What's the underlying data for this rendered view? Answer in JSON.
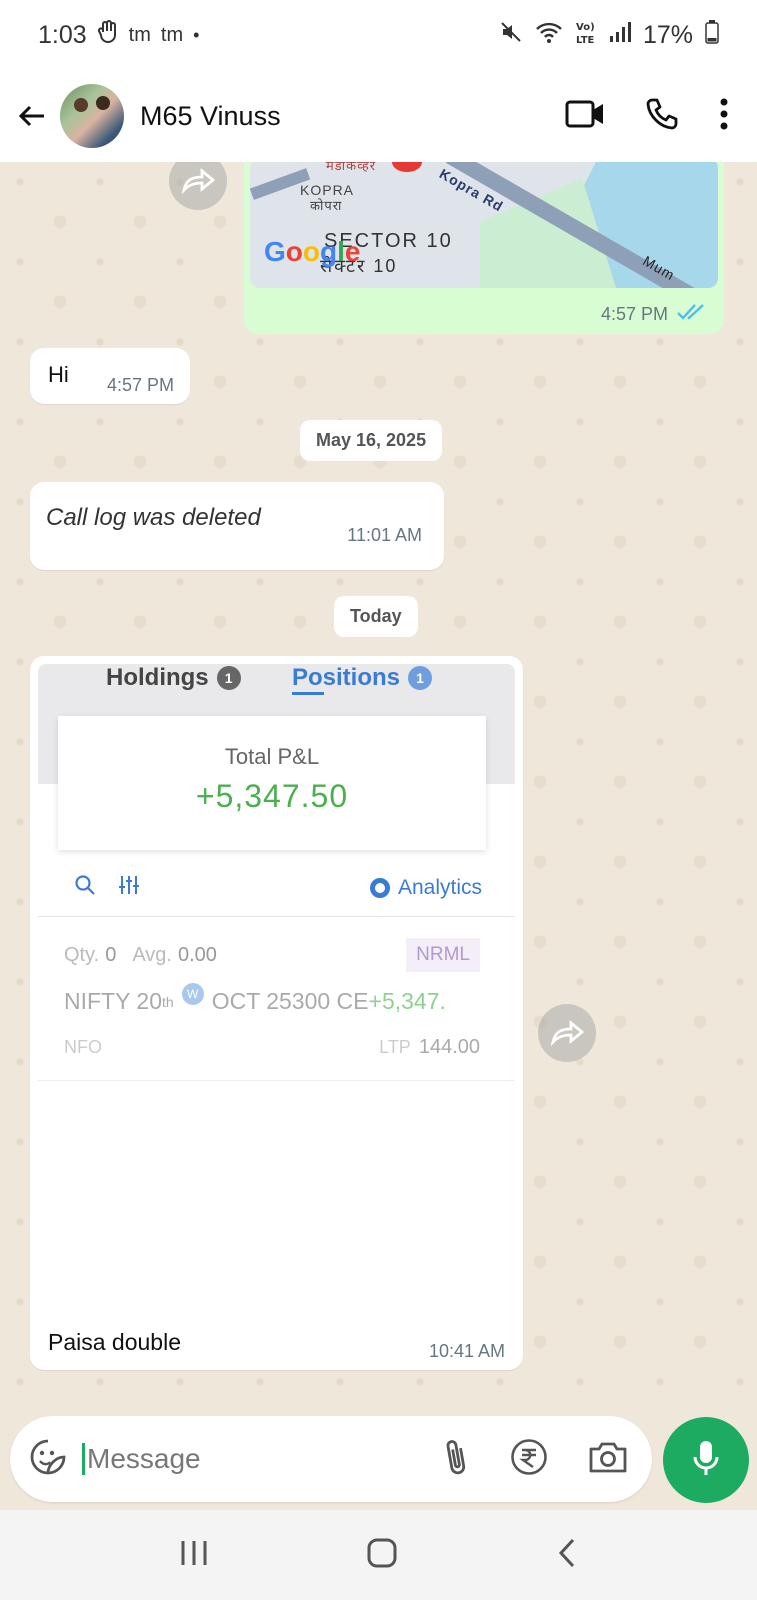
{
  "status_bar": {
    "time": "1:03",
    "carrier_1": "tm",
    "carrier_2": "tm",
    "dot": "•",
    "battery": "17%",
    "icons": [
      "gesture-hand-icon",
      "mute-icon",
      "wifi-icon",
      "volte-icon",
      "signal-icon",
      "battery-icon"
    ]
  },
  "header": {
    "contact_name": "M65 Vinuss",
    "icons": [
      "back-arrow-icon",
      "video-call-icon",
      "phone-icon",
      "more-vert-icon"
    ]
  },
  "messages": {
    "map": {
      "labels": {
        "hindi_top": "मंडाकव्हर",
        "kopra": "KOPRA",
        "kopra_hi": "कोपरा",
        "road": "Kopra Rd",
        "sector": "SECTOR 10",
        "sector_hi": "सेक्टर 10",
        "mum": "Mum"
      },
      "google": [
        "G",
        "o",
        "o",
        "g",
        "l",
        "e"
      ],
      "time": "4:57 PM",
      "status_icon": "double-check-icon"
    },
    "hi": {
      "text": "Hi",
      "time": "4:57 PM"
    },
    "date_1": "May 16, 2025",
    "call_log": {
      "text": "Call log was deleted",
      "time": "11:01 AM"
    },
    "date_2": "Today",
    "screenshot": {
      "tabs": [
        {
          "label": "Holdings",
          "count": "1"
        },
        {
          "label": "Positions",
          "count": "1"
        }
      ],
      "pl_label": "Total P&L",
      "pl_value": "+5,347.50",
      "analytics_label": "Analytics",
      "position": {
        "qty_label": "Qty.",
        "qty_value": "0",
        "avg_label": "Avg.",
        "avg_value": "0.00",
        "product": "NRML",
        "symbol_pre": "NIFTY 20",
        "symbol_sup": "th",
        "badge": "W",
        "symbol_post": "OCT 25300 CE",
        "pnl": "+5,347.",
        "exchange": "NFO",
        "ltp_label": "LTP",
        "ltp_value": "144.00"
      },
      "caption": "Paisa double",
      "time": "10:41 AM"
    }
  },
  "input": {
    "placeholder": "Message",
    "icons": [
      "sticker-icon",
      "attach-icon",
      "rupee-payment-icon",
      "camera-icon",
      "mic-icon"
    ]
  },
  "navbar": {
    "icons": [
      "recent-apps-icon",
      "home-icon",
      "back-icon"
    ]
  },
  "colors": {
    "accent": "#1daa61",
    "outgoing_bubble": "#d9fdd3",
    "chat_bg": "#efe7da",
    "pnl_green": "#4caf50",
    "tick_blue": "#53bdeb"
  }
}
